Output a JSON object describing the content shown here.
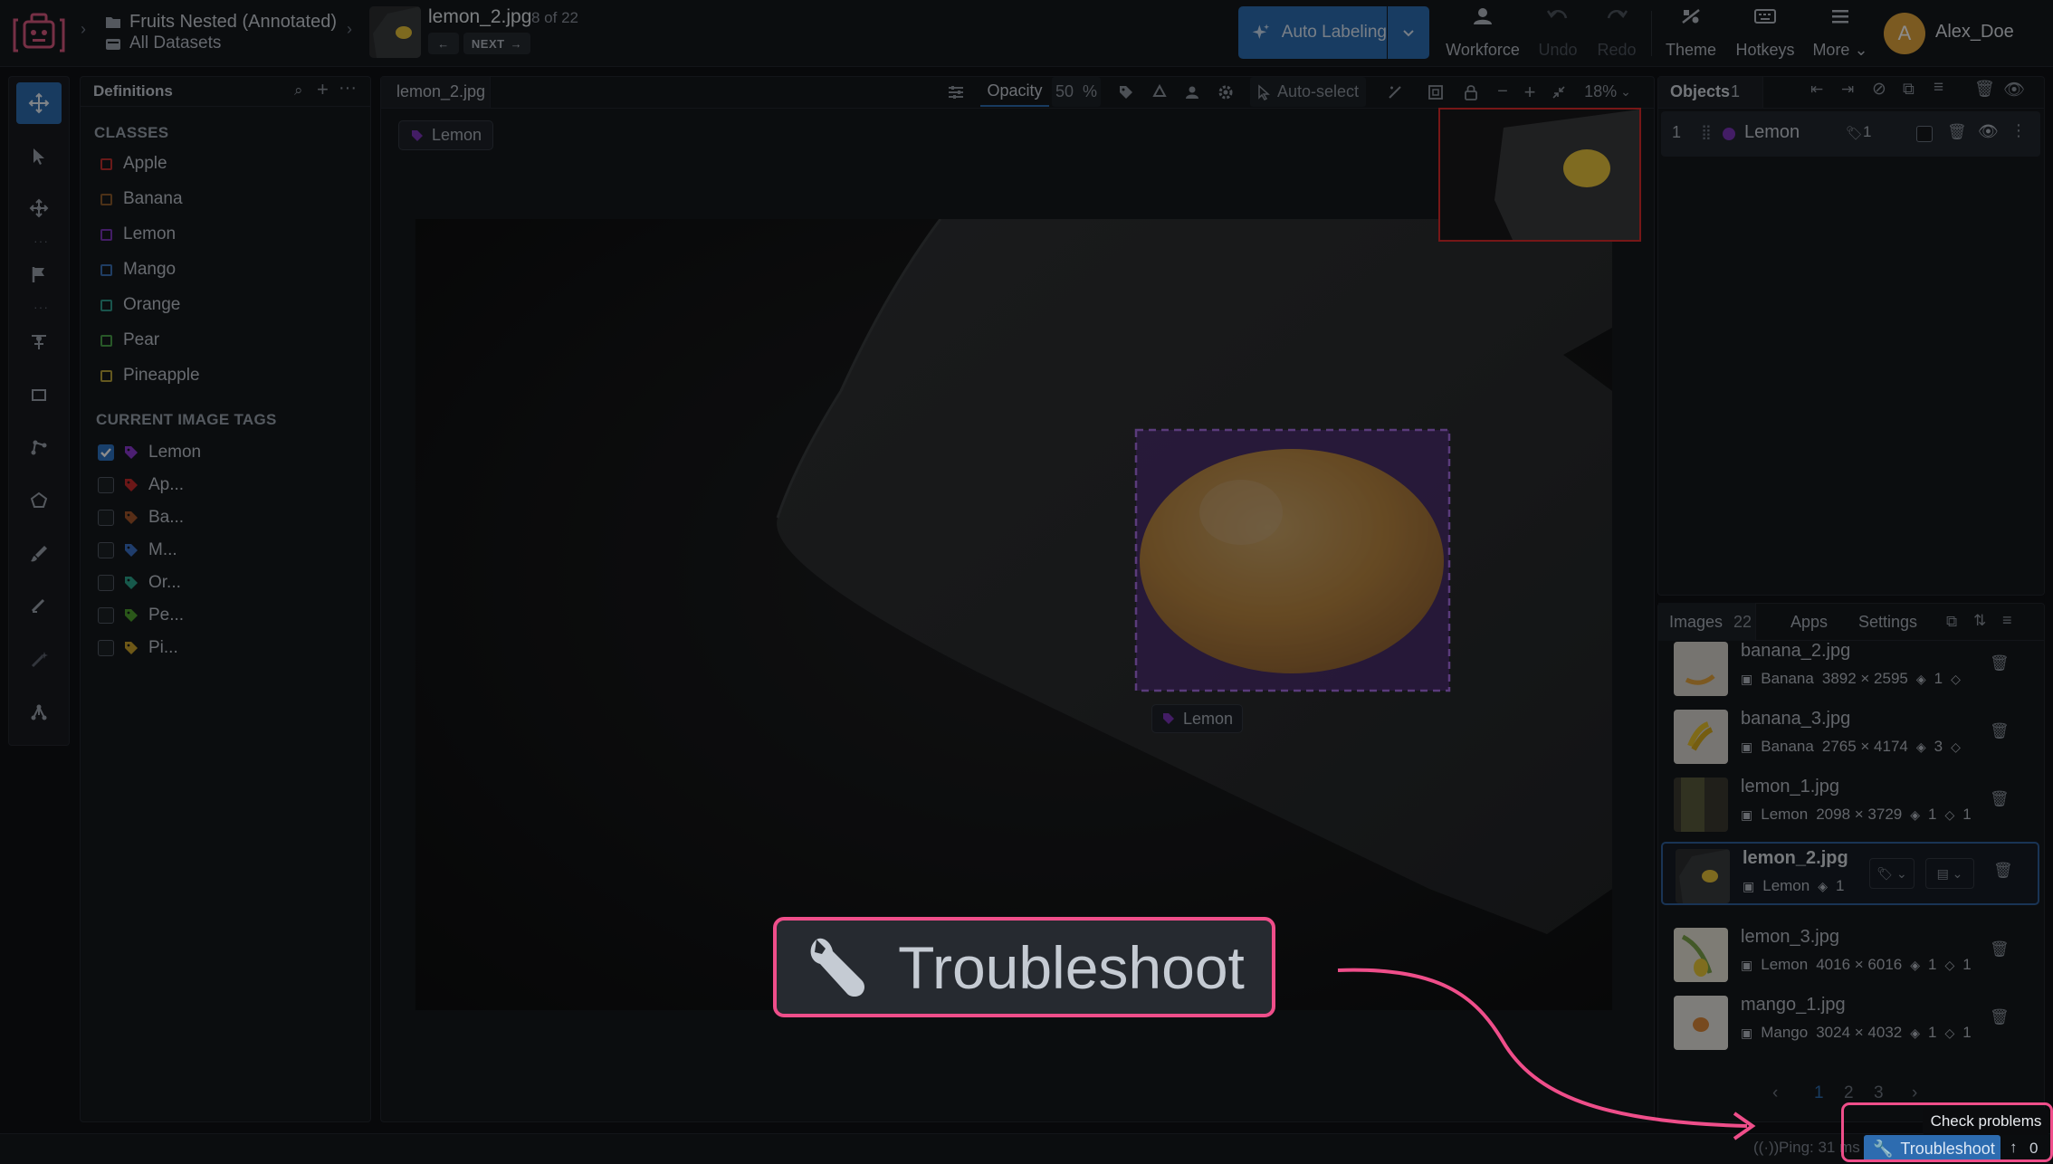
{
  "header": {
    "project": "Fruits Nested (Annotated)",
    "dataset": "All Datasets",
    "image_name": "lemon_2.jpg",
    "image_counter": "8 of 22",
    "next_label": "NEXT",
    "auto_labeling": "Auto Labeling",
    "workforce": "Workforce",
    "undo": "Undo",
    "redo": "Redo",
    "theme": "Theme",
    "hotkeys": "Hotkeys",
    "more": "More",
    "user": "Alex_Doe",
    "avatar_letter": "A"
  },
  "definitions": {
    "tab": "Definitions",
    "classes_title": "CLASSES",
    "classes": [
      {
        "name": "Apple",
        "color": "#c0302f"
      },
      {
        "name": "Banana",
        "color": "#8a5a2a"
      },
      {
        "name": "Lemon",
        "color": "#7a35b8"
      },
      {
        "name": "Mango",
        "color": "#3a6fb5"
      },
      {
        "name": "Orange",
        "color": "#2f9a8a"
      },
      {
        "name": "Pear",
        "color": "#4aa04a"
      },
      {
        "name": "Pineapple",
        "color": "#b6a13a"
      }
    ],
    "tags_title": "CURRENT IMAGE TAGS",
    "tags": [
      {
        "name": "Lemon",
        "color": "#8a3ad0",
        "checked": true
      },
      {
        "name": "Ap...",
        "color": "#c32a2a",
        "checked": false
      },
      {
        "name": "Ba...",
        "color": "#a0552a",
        "checked": false
      },
      {
        "name": "M...",
        "color": "#3a6fc5",
        "checked": false
      },
      {
        "name": "Or...",
        "color": "#2aa38a",
        "checked": false
      },
      {
        "name": "Pe...",
        "color": "#4d9e2f",
        "checked": false
      },
      {
        "name": "Pi...",
        "color": "#c9a12a",
        "checked": false
      }
    ]
  },
  "canvas": {
    "tab": "lemon_2.jpg",
    "opacity_label": "Opacity",
    "opacity_value": "50",
    "opacity_unit": "%",
    "auto_select": "Auto-select",
    "zoom": "18%",
    "image_tag": "Lemon",
    "object_label": "Lemon"
  },
  "objects": {
    "title": "Objects",
    "count": "1",
    "items": [
      {
        "index": "1",
        "class": "Lemon",
        "tags": "1",
        "color": "#7a35b8"
      }
    ]
  },
  "images": {
    "tab_images": "Images",
    "count": "22",
    "tab_apps": "Apps",
    "tab_settings": "Settings",
    "rows": [
      {
        "name": "banana_2.jpg",
        "dataset": "Banana",
        "size": "3892 × 2595",
        "objects": "1",
        "tags": "",
        "selected": false
      },
      {
        "name": "banana_3.jpg",
        "dataset": "Banana",
        "size": "2765 × 4174",
        "objects": "3",
        "tags": "",
        "selected": false
      },
      {
        "name": "lemon_1.jpg",
        "dataset": "Lemon",
        "size": "2098 × 3729",
        "objects": "1",
        "tags": "1",
        "selected": false
      },
      {
        "name": "lemon_2.jpg",
        "dataset": "Lemon",
        "size": "",
        "objects": "1",
        "tags": "",
        "selected": true
      },
      {
        "name": "lemon_3.jpg",
        "dataset": "Lemon",
        "size": "4016 × 6016",
        "objects": "1",
        "tags": "1",
        "selected": false
      },
      {
        "name": "mango_1.jpg",
        "dataset": "Mango",
        "size": "3024 × 4032",
        "objects": "1",
        "tags": "1",
        "selected": false
      }
    ],
    "pages": [
      "1",
      "2",
      "3"
    ],
    "current_page": "1"
  },
  "status": {
    "ping": "Ping: 31 ms",
    "troubleshoot": "Troubleshoot",
    "uploads": "0",
    "tooltip": "Check problems"
  },
  "callout": {
    "text": "Troubleshoot",
    "accent": "#ef4e8a"
  },
  "colors": {
    "accent_blue": "#2d6cb0",
    "highlight_pink": "#ef4e8a",
    "minimap_frame": "#d92b2b",
    "lemon_purple": "#7a35b8"
  }
}
